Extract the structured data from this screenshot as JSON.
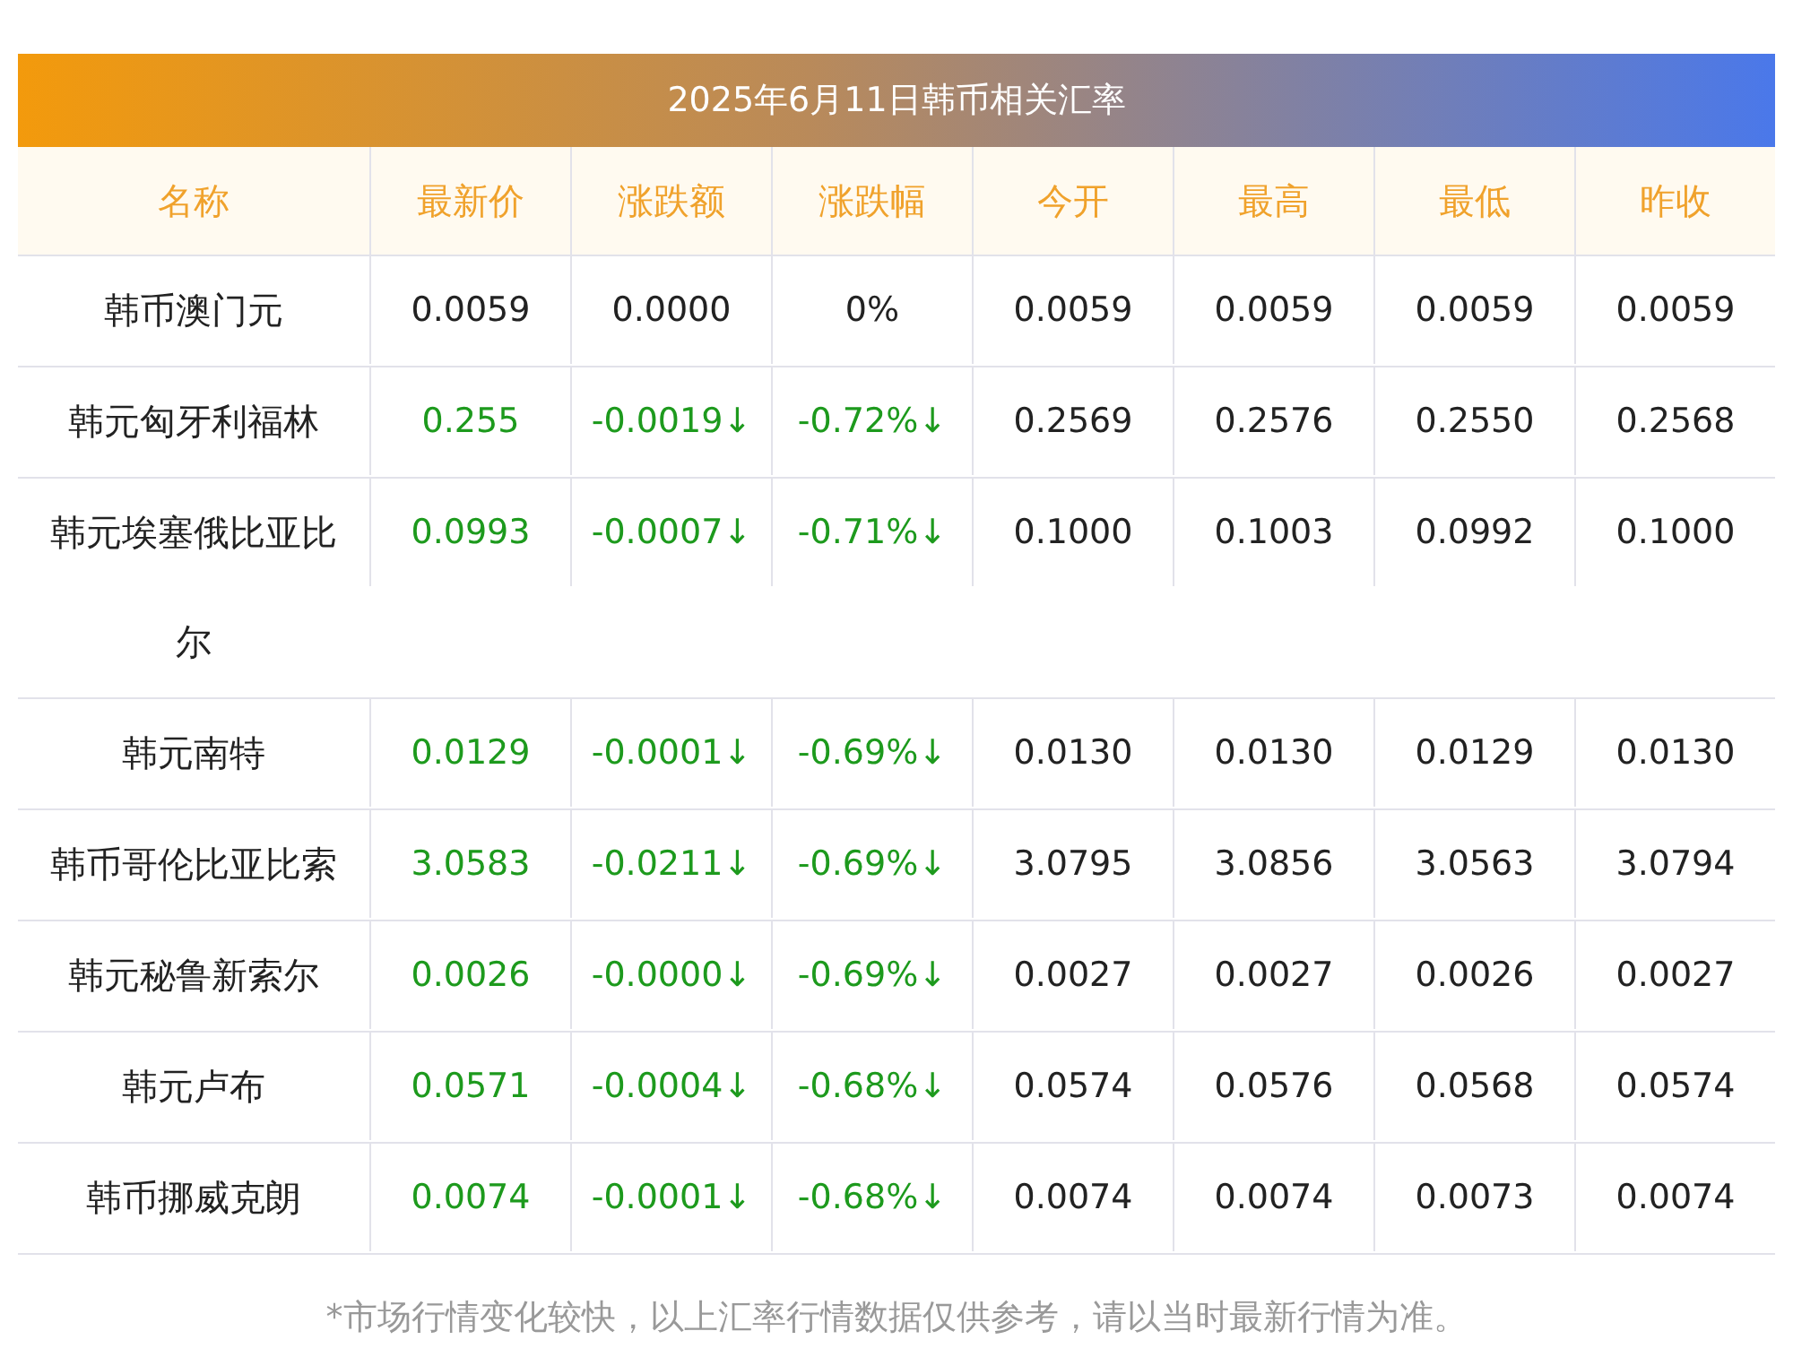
{
  "title": "2025年6月11日韩币相关汇率",
  "columns": [
    "名称",
    "最新价",
    "涨跌额",
    "涨跌幅",
    "今开",
    "最高",
    "最低",
    "昨收"
  ],
  "rows": [
    {
      "name": "韩币澳门元",
      "kind": "flat",
      "price": "0.0059",
      "change": "0.0000",
      "percent": "0%",
      "open": "0.0059",
      "high": "0.0059",
      "low": "0.0059",
      "prev_close": "0.0059"
    },
    {
      "name": "韩元匈牙利福林",
      "kind": "down",
      "price": "0.255",
      "change": "-0.0019↓",
      "percent": "-0.72%↓",
      "open": "0.2569",
      "high": "0.2576",
      "low": "0.2550",
      "prev_close": "0.2568"
    },
    {
      "name": "韩元埃塞俄比亚比尔",
      "kind": "down",
      "price": "0.0993",
      "change": "-0.0007↓",
      "percent": "-0.71%↓",
      "open": "0.1000",
      "high": "0.1003",
      "low": "0.0992",
      "prev_close": "0.1000"
    },
    {
      "name": "韩元南特",
      "kind": "down",
      "price": "0.0129",
      "change": "-0.0001↓",
      "percent": "-0.69%↓",
      "open": "0.0130",
      "high": "0.0130",
      "low": "0.0129",
      "prev_close": "0.0130"
    },
    {
      "name": "韩币哥伦比亚比索",
      "kind": "down",
      "price": "3.0583",
      "change": "-0.0211↓",
      "percent": "-0.69%↓",
      "open": "3.0795",
      "high": "3.0856",
      "low": "3.0563",
      "prev_close": "3.0794"
    },
    {
      "name": "韩元秘鲁新索尔",
      "kind": "down",
      "price": "0.0026",
      "change": "-0.0000↓",
      "percent": "-0.69%↓",
      "open": "0.0027",
      "high": "0.0027",
      "low": "0.0026",
      "prev_close": "0.0027"
    },
    {
      "name": "韩元卢布",
      "kind": "down",
      "price": "0.0571",
      "change": "-0.0004↓",
      "percent": "-0.68%↓",
      "open": "0.0574",
      "high": "0.0576",
      "low": "0.0568",
      "prev_close": "0.0574"
    },
    {
      "name": "韩币挪威克朗",
      "kind": "down",
      "price": "0.0074",
      "change": "-0.0001↓",
      "percent": "-0.68%↓",
      "open": "0.0074",
      "high": "0.0074",
      "low": "0.0073",
      "prev_close": "0.0074"
    }
  ],
  "footnote": "*市场行情变化较快，以上汇率行情数据仅供参考，请以当时最新行情为准。"
}
